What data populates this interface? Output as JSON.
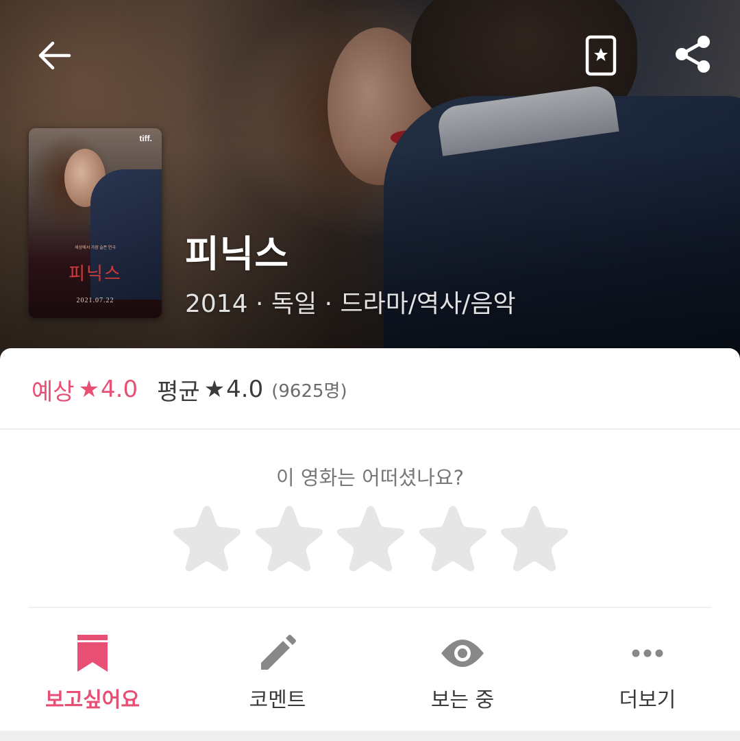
{
  "hero": {
    "title": "피닉스",
    "meta": "2014 · 독일 · 드라마/역사/음악",
    "icons": {
      "back": "arrow-left-icon",
      "bookmark": "bookmark-star-icon",
      "share": "share-icon"
    }
  },
  "poster": {
    "logo": "tiff.",
    "tagline": "세상에서 가장 슬픈 연극",
    "title": "피닉스",
    "date": "2021.07.22"
  },
  "ratings": {
    "expected_label": "예상",
    "expected_value": "4.0",
    "average_label": "평균",
    "average_value": "4.0",
    "count": "(9625명)",
    "star_glyph": "★"
  },
  "rate_prompt": {
    "question": "이 영화는 어떠셨나요?",
    "stars": 5,
    "selected": 0
  },
  "actions": [
    {
      "label": "보고싶어요",
      "icon": "bookmark-ribbon-icon",
      "active": true
    },
    {
      "label": "코멘트",
      "icon": "pencil-icon",
      "active": false
    },
    {
      "label": "보는 중",
      "icon": "eye-icon",
      "active": false
    },
    {
      "label": "더보기",
      "icon": "more-dots-icon",
      "active": false
    }
  ],
  "colors": {
    "accent": "#e84f74",
    "text_dark": "#3a3a3a",
    "text_muted": "#777777",
    "star_empty": "#e6e6e6",
    "icon_gray": "#888888"
  }
}
